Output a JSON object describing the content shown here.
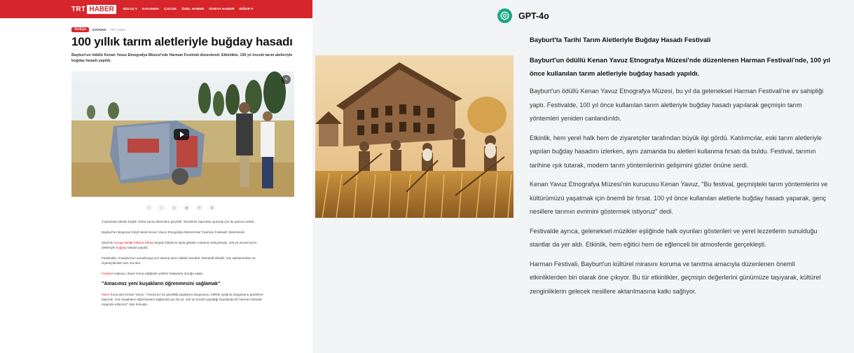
{
  "left": {
    "nav": {
      "logo_trt": "TRT",
      "logo_haber": "HABER",
      "items": [
        "BİGAŞ ▾",
        "SAVUNMA",
        "ÇOCUK",
        "ÖZEL HABER",
        "DOBYA HABER",
        "DİĞER ▾"
      ]
    },
    "category": "Türkiye",
    "source_label": "KAYNAK:",
    "source_name": "TRT Haber",
    "headline": "100 yıllık tarım aletleriyle buğday hasadı",
    "lede": "Bayburt'un ödüllü Kenan Yavuz Etnografya Müzesi'nde Harman Festivali düzenlendi. Etkinlikte, 100 yıl önceki tarım aletleriyle buğday hasadı yapıldı.",
    "share_icons": [
      "f",
      "x",
      "in",
      "◉",
      "✉",
      "⧉"
    ],
    "paragraphs": [
      "Tırpanlarla ekinler biçildi. Daha sonra dövenden geçirildi. Tanelerini sapından ayırmak için de patoza verildi...",
      "Bayburt'un Beşpınar Köyü'ndeki Kenan Yavuz Etnografya Müzesi'nde \"Harman Festivali\" düzenlendi."
    ],
    "para3": {
      "before": "2022'de ",
      "link": "Avrupa Birliği Kültürel Mirası",
      "middle": " Büyük Ödülü'ne layık görülen müzenin bahçesinde, 100 yıl önceki tarım aletleriyle ",
      "link2": "buğday",
      "after": " hasadı yapıldı."
    },
    "para4": "Festivalde, Anadolu'nun unutulmaya yüz tutmuş tarım aletleri tanıtıldı. İnteraktif etkinlik, köy sakinlerinden ve ziyaretçilerden tam not aldı.",
    "para5": {
      "link": "Festival",
      "after": " coşkusu, davul zurna eşliğinde çekilen halaylarla doruğa ulaştı."
    },
    "subhead": "\"Amacımız yeni kuşakların öğrenmesini sağlamak\"",
    "para6": {
      "link": "Müze",
      "after": " Kurucusu Kenan Yavuz, \"Amacımız bu güzelliği paylaşma duygusunu, birlikte çalışma duygusunu gündeme taşımak. Yeni kuşakların öğrenmesini sağlamak için 50 yıl, 100 yıl önceki yapıldığı koşullarda bir harman festivali organize ediyoruz\" diye konuştu."
    }
  },
  "right": {
    "model_name": "GPT-4o",
    "title": "Bayburt'ta Tarihi Tarım Aletleriyle Buğday Hasadı Festivali",
    "lede": "Bayburt'un ödüllü Kenan Yavuz Etnografya Müzesi'nde düzenlenen Harman Festivali'nde, 100 yıl önce kullanılan tarım aletleriyle buğday hasadı yapıldı.",
    "paragraphs": [
      "Bayburt'un ödüllü Kenan Yavuz Etnografya Müzesi, bu yıl da geleneksel Harman Festivali'ne ev sahipliği yaptı. Festivalde, 100 yıl önce kullanılan tarım aletleriyle buğday hasadı yapılarak geçmişin tarım yöntemleri yeniden canlandırıldı.",
      "Etkinlik, hem yerel halk hem de ziyaretçiler tarafından büyük ilgi gördü. Katılımcılar, eski tarım aletleriyle yapılan buğday hasadını izlerken, aynı zamanda bu aletleri kullanma fırsatı da buldu. Festival, tarımın tarihine ışık tutarak, modern tarım yöntemlerinin gelişimini gözler önüne serdi.",
      "Kenan Yavuz Etnografya Müzesi'nin kurucusu Kenan Yavuz, \"Bu festival, geçmişteki tarım yöntemlerini ve kültürümüzü yaşatmak için önemli bir fırsat. 100 yıl önce kullanılan aletlerle buğday hasadı yaparak, genç nesillere tarımın evrimini göstermek istiyoruz\" dedi.",
      "Festivalde ayrıca, geleneksel müzikler eşliğinde halk oyunları gösterileri ve yerel lezzetlerin sunulduğu stantlar da yer aldı. Etkinlik, hem eğitici hem de eğlenceli bir atmosferde gerçekleşti.",
      "Harman Festivali, Bayburt'un kültürel mirasını koruma ve tanıtma amacıyla düzenlenen önemli etkinliklerden biri olarak öne çıkıyor. Bu tür etkinlikler, geçmişin değerlerini günümüze taşıyarak, kültürel zenginliklerin gelecek nesillere aktarılmasına katkı sağlıyor."
    ]
  },
  "colors": {
    "trt_red": "#d7262b",
    "gpt_green": "#19a784",
    "right_bg": "#f3f4f6"
  }
}
